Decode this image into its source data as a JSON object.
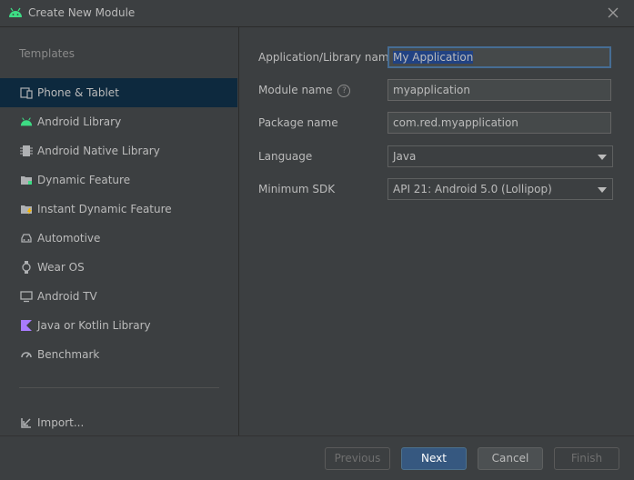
{
  "window": {
    "title": "Create New Module",
    "icon": "android-icon",
    "close_icon": "close-icon"
  },
  "sidebar": {
    "heading": "Templates",
    "items": [
      {
        "label": "Phone & Tablet",
        "icon": "phone-tablet-icon",
        "selected": true
      },
      {
        "label": "Android Library",
        "icon": "android-icon"
      },
      {
        "label": "Android Native Library",
        "icon": "native-library-icon"
      },
      {
        "label": "Dynamic Feature",
        "icon": "folder-icon"
      },
      {
        "label": "Instant Dynamic Feature",
        "icon": "folder-bolt-icon"
      },
      {
        "label": "Automotive",
        "icon": "car-icon"
      },
      {
        "label": "Wear OS",
        "icon": "watch-icon"
      },
      {
        "label": "Android TV",
        "icon": "tv-icon"
      },
      {
        "label": "Java or Kotlin Library",
        "icon": "kotlin-icon"
      },
      {
        "label": "Benchmark",
        "icon": "gauge-icon"
      }
    ],
    "import_label": "Import..."
  },
  "form": {
    "app_name": {
      "label": "Application/Library name",
      "value": "My Application"
    },
    "module_name": {
      "label": "Module name",
      "value": "myapplication",
      "help_icon": "?"
    },
    "package_name": {
      "label": "Package name",
      "value": "com.red.myapplication"
    },
    "language": {
      "label": "Language",
      "value": "Java"
    },
    "min_sdk": {
      "label": "Minimum SDK",
      "value": "API 21: Android 5.0 (Lollipop)"
    }
  },
  "footer": {
    "previous": "Previous",
    "next": "Next",
    "cancel": "Cancel",
    "finish": "Finish"
  },
  "colors": {
    "accent": "#365880",
    "selection": "#0d293e",
    "android_green": "#3ddc84",
    "background": "#3c3f41"
  }
}
